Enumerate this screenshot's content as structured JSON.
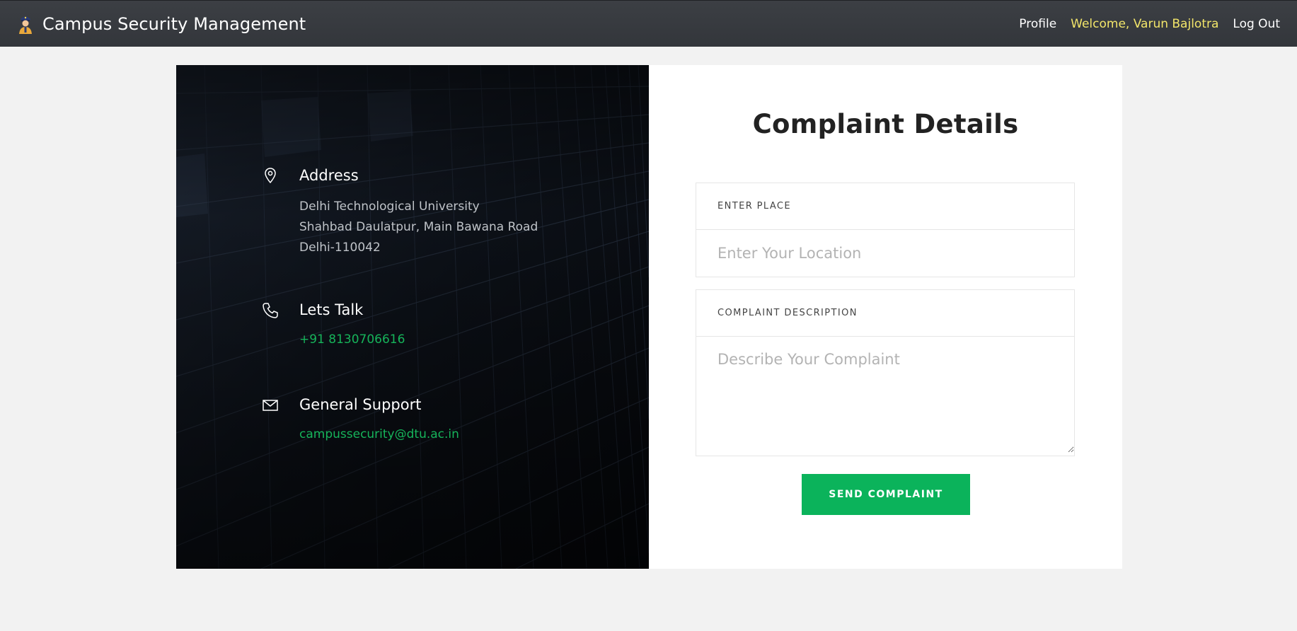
{
  "navbar": {
    "brand": "Campus Security Management",
    "brand_icon": "security-guard-icon",
    "profile": "Profile",
    "welcome": "Welcome, Varun Bajlotra",
    "logout": "Log Out",
    "welcome_color": "#f3e66a"
  },
  "contact": {
    "address": {
      "icon": "map-pin-icon",
      "title": "Address",
      "lines": [
        "Delhi Technological University",
        "Shahbad Daulatpur, Main Bawana Road",
        "Delhi-110042"
      ]
    },
    "phone": {
      "icon": "phone-icon",
      "title": "Lets Talk",
      "value": "+91 8130706616"
    },
    "email": {
      "icon": "envelope-icon",
      "title": "General Support",
      "value": "campussecurity@dtu.ac.in"
    },
    "link_color": "#16b45a"
  },
  "form": {
    "title": "Complaint Details",
    "place": {
      "label": "ENTER PLACE",
      "placeholder": "Enter Your Location",
      "value": ""
    },
    "description": {
      "label": "COMPLAINT DESCRIPTION",
      "placeholder": "Describe Your Complaint",
      "value": ""
    },
    "submit_label": "SEND COMPLAINT",
    "submit_color": "#0bb35b"
  }
}
